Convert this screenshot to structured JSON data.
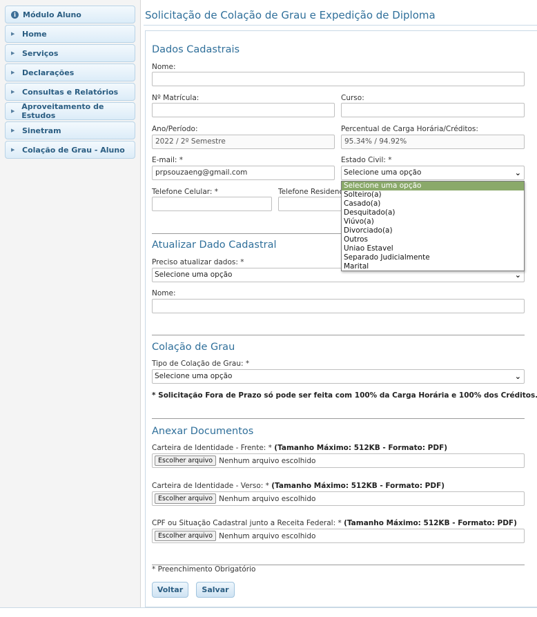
{
  "sidebar": {
    "items": [
      {
        "label": "Módulo Aluno",
        "icon": "info-icon"
      },
      {
        "label": "Home",
        "icon": "arrow-right-icon"
      },
      {
        "label": "Serviços",
        "icon": "arrow-right-icon"
      },
      {
        "label": "Declarações",
        "icon": "arrow-right-icon"
      },
      {
        "label": "Consultas e Relatórios",
        "icon": "arrow-right-icon"
      },
      {
        "label": "Aproveitamento de Estudos",
        "icon": "arrow-right-icon"
      },
      {
        "label": "Sinetram",
        "icon": "arrow-right-icon"
      },
      {
        "label": "Colação de Grau - Aluno",
        "icon": "arrow-right-icon"
      }
    ]
  },
  "page": {
    "title": "Solicitação de Colação de Grau e Expedição de Diploma"
  },
  "dados": {
    "heading": "Dados Cadastrais",
    "nome_label": "Nome:",
    "nome_value": "",
    "matricula_label": "Nº Matrícula:",
    "matricula_value": "",
    "curso_label": "Curso:",
    "curso_value": "",
    "ano_label": "Ano/Período:",
    "ano_value": "2022 / 2º Semestre",
    "percentual_label": "Percentual de Carga Horária/Créditos:",
    "percentual_value": "95.34% / 94.92%",
    "email_label": "E-mail: *",
    "email_value": "prpsouzaeng@gmail.com",
    "estado_civil_label": "Estado Civil: *",
    "estado_civil_value": "Selecione uma opção",
    "estado_civil_options": [
      "Selecione uma opção",
      "Solteiro(a)",
      "Casado(a)",
      "Desquitado(a)",
      "Viúvo(a)",
      "Divorciado(a)",
      "Outros",
      "Uniao Estavel",
      "Separado Judicialmente",
      "Marital"
    ],
    "celular_label": "Telefone Celular: *",
    "celular_value": "",
    "residencial_label": "Telefone Residencial:",
    "residencial_value": ""
  },
  "atualizar": {
    "heading": "Atualizar Dado Cadastral",
    "preciso_label": "Preciso atualizar dados: *",
    "preciso_value": "Selecione uma opção",
    "nome_label": "Nome:",
    "nome_value": ""
  },
  "colacao": {
    "heading": "Colação de Grau",
    "tipo_label": "Tipo de Colação de Grau: *",
    "tipo_value": "Selecione uma opção",
    "note": "* Solicitação Fora de Prazo só pode ser feita com 100% da Carga Horária e 100% dos Créditos.'"
  },
  "anexos": {
    "heading": "Anexar Documentos",
    "files": [
      {
        "label": "Carteira de Identidade - Frente: *",
        "hint": "(Tamanho Máximo: 512KB - Formato: PDF)",
        "button": "Escolher arquivo",
        "status": "Nenhum arquivo escolhido"
      },
      {
        "label": "Carteira de Identidade - Verso: *",
        "hint": "(Tamanho Máximo: 512KB - Formato: PDF)",
        "button": "Escolher arquivo",
        "status": "Nenhum arquivo escolhido"
      },
      {
        "label": "CPF ou Situação Cadastral junto a Receita Federal: *",
        "hint": "(Tamanho Máximo: 512KB - Formato: PDF)",
        "button": "Escolher arquivo",
        "status": "Nenhum arquivo escolhido"
      }
    ]
  },
  "footer": {
    "required_note": "* Preenchimento Obrigatório",
    "voltar_label": "Voltar",
    "salvar_label": "Salvar"
  },
  "colors": {
    "accent": "#2f6f9a",
    "highlight": "#8aa96a"
  }
}
